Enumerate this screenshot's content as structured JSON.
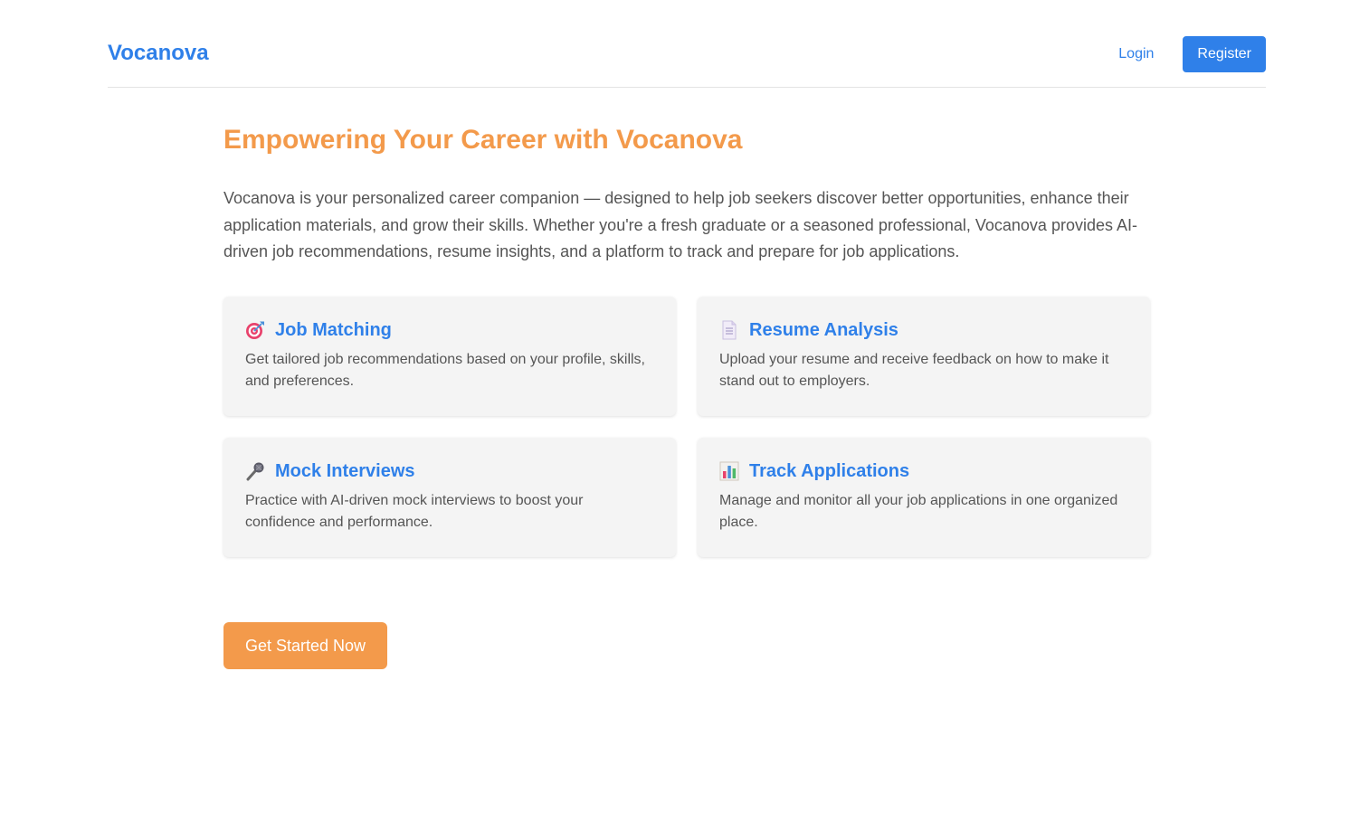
{
  "header": {
    "brand": "Vocanova",
    "login_label": "Login",
    "register_label": "Register"
  },
  "hero": {
    "title": "Empowering Your Career with Vocanova",
    "description": "Vocanova is your personalized career companion — designed to help job seekers discover better opportunities, enhance their application materials, and grow their skills. Whether you're a fresh graduate or a seasoned professional, Vocanova provides AI-driven job recommendations, resume insights, and a platform to track and prepare for job applications."
  },
  "features": [
    {
      "icon": "target-icon",
      "title": "Job Matching",
      "text": "Get tailored job recommendations based on your profile, skills, and preferences."
    },
    {
      "icon": "document-icon",
      "title": "Resume Analysis",
      "text": "Upload your resume and receive feedback on how to make it stand out to employers."
    },
    {
      "icon": "microphone-icon",
      "title": "Mock Interviews",
      "text": "Practice with AI-driven mock interviews to boost your confidence and performance."
    },
    {
      "icon": "bar-chart-icon",
      "title": "Track Applications",
      "text": "Manage and monitor all your job applications in one organized place."
    }
  ],
  "cta": {
    "label": "Get Started Now"
  },
  "colors": {
    "primary": "#2f80e9",
    "accent": "#f39a4b",
    "card_bg": "#f4f4f4"
  }
}
